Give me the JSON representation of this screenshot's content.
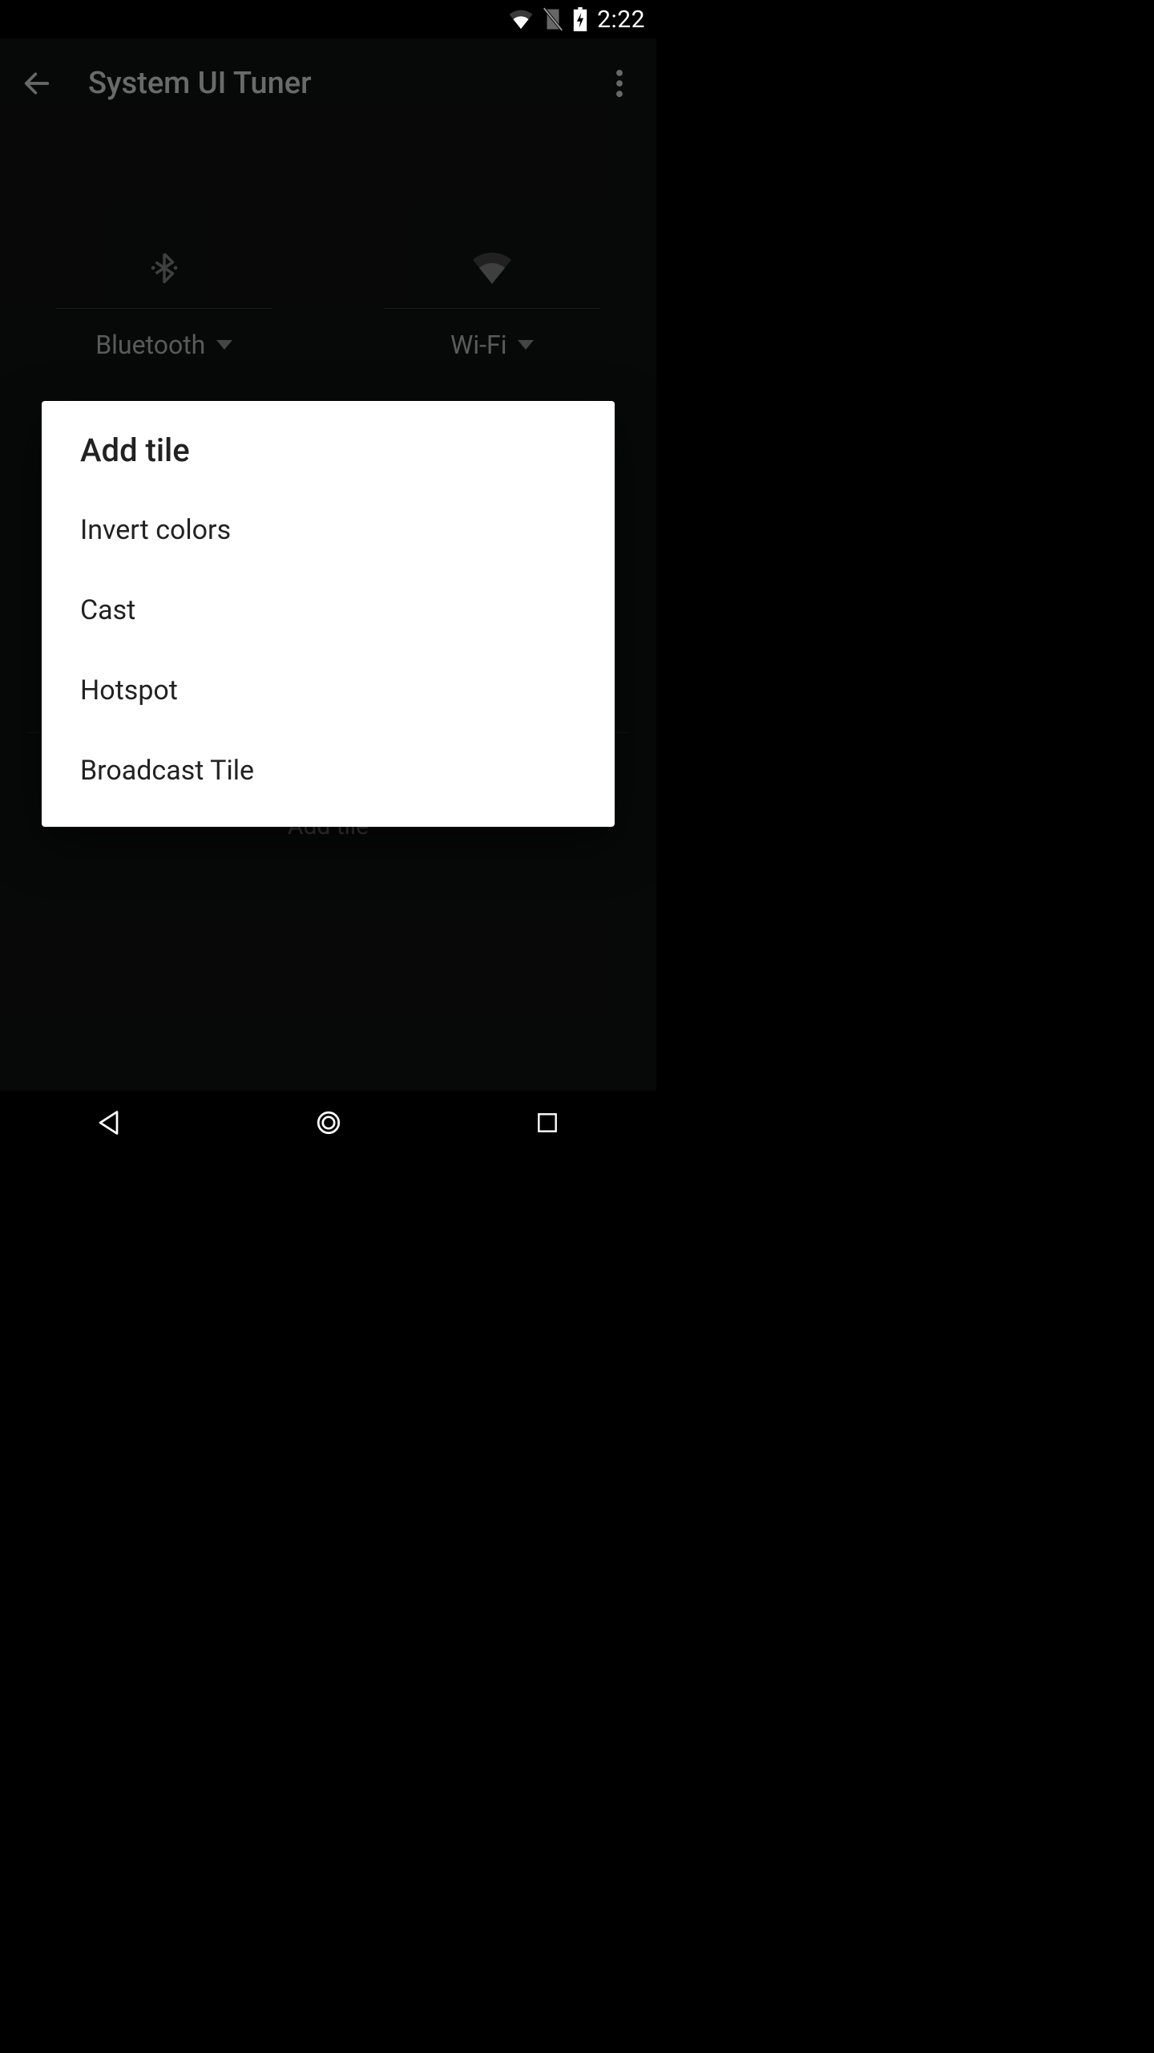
{
  "status": {
    "time": "2:22"
  },
  "appbar": {
    "title": "System UI Tuner"
  },
  "tiles": [
    {
      "label": "Bluetooth"
    },
    {
      "label": "Wi-Fi"
    }
  ],
  "add_tile_background": "Add tile",
  "dialog": {
    "title": "Add tile",
    "items": [
      "Invert colors",
      "Cast",
      "Hotspot",
      "Broadcast Tile"
    ]
  }
}
